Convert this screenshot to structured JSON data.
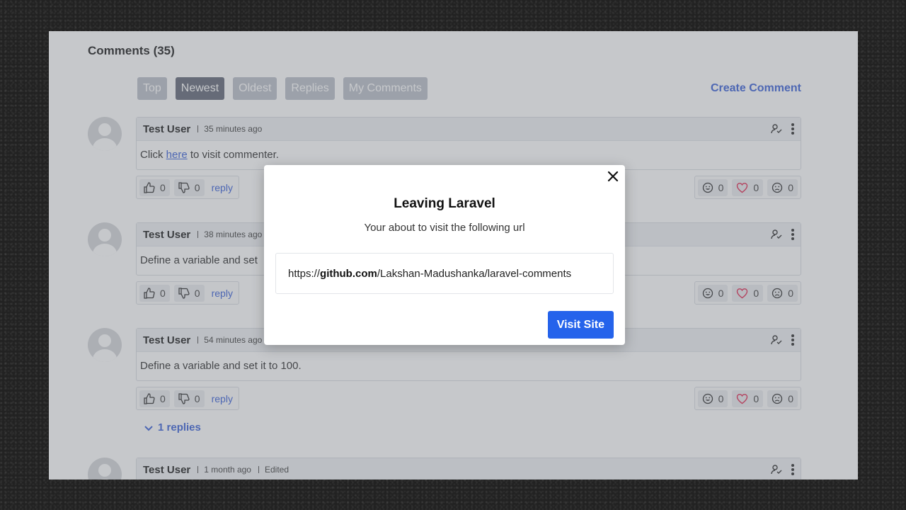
{
  "header": {
    "title": "Comments (35)",
    "create_label": "Create Comment"
  },
  "tabs": [
    {
      "label": "Top"
    },
    {
      "label": "Newest"
    },
    {
      "label": "Oldest"
    },
    {
      "label": "Replies"
    },
    {
      "label": "My Comments"
    }
  ],
  "comments": [
    {
      "user": "Test User",
      "time": "35 minutes ago",
      "text_before": "Click ",
      "link": "here",
      "text_after": " to visit commenter.",
      "likes": "0",
      "dislikes": "0",
      "reply_label": "reply",
      "smile": "0",
      "heart": "0",
      "sad": "0"
    },
    {
      "user": "Test User",
      "time": "38 minutes ago",
      "text": "Define a variable and set",
      "likes": "0",
      "dislikes": "0",
      "reply_label": "reply",
      "smile": "0",
      "heart": "0",
      "sad": "0"
    },
    {
      "user": "Test User",
      "time": "54 minutes ago",
      "text": "Define a variable and set it to 100.",
      "likes": "0",
      "dislikes": "0",
      "reply_label": "reply",
      "smile": "0",
      "heart": "0",
      "sad": "0"
    },
    {
      "user": "Test User",
      "time": "1 month ago",
      "edited": "Edited"
    }
  ],
  "replies_toggle": "1 replies",
  "modal": {
    "title": "Leaving Laravel",
    "subtitle": "Your about to visit the following url",
    "url_prefix": "https://",
    "url_domain": "github.com",
    "url_path": "/Lakshan-Madushanka/laravel-comments",
    "button_label": "Visit Site"
  },
  "colors": {
    "accent": "#2563eb",
    "link": "#2f58d6",
    "heart": "#e11d48"
  }
}
